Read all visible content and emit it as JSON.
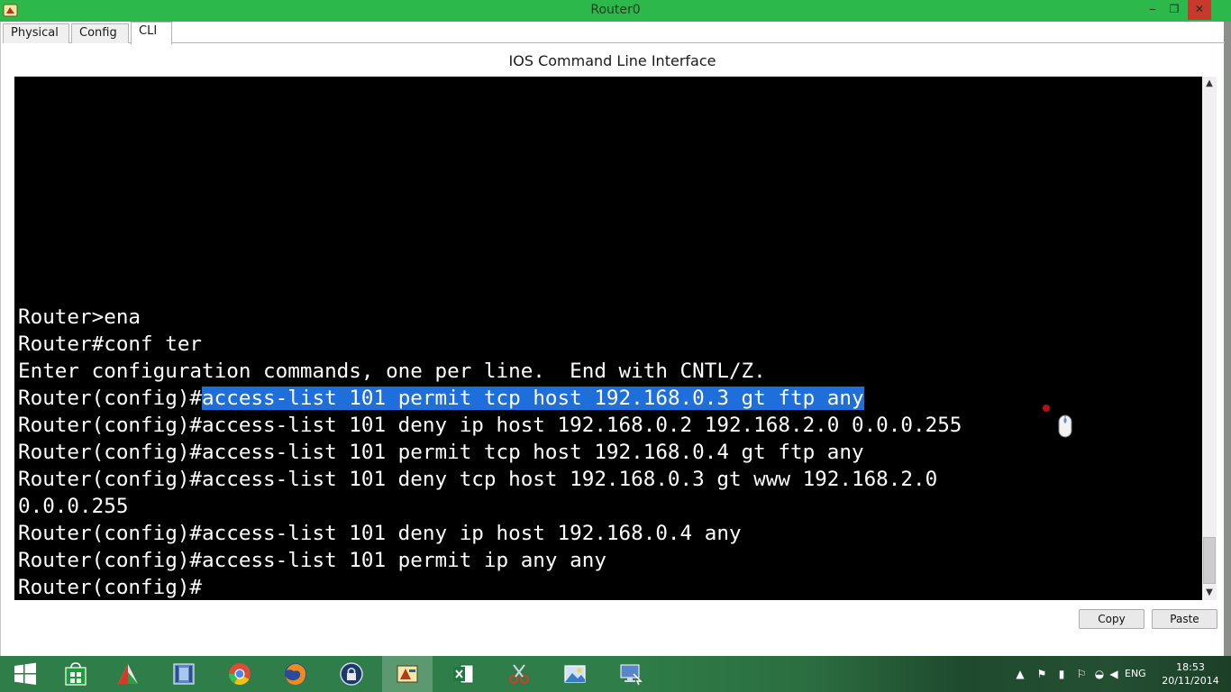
{
  "window": {
    "title": "Router0",
    "minimize_glyph": "‒",
    "maximize_glyph": "❐",
    "close_glyph": "✕"
  },
  "tabs": [
    {
      "label": "Physical"
    },
    {
      "label": "Config"
    },
    {
      "label": "CLI"
    }
  ],
  "cli": {
    "heading": "IOS Command Line Interface",
    "lines": [
      {
        "text": "Router>ena"
      },
      {
        "text": "Router#conf ter"
      },
      {
        "text": "Enter configuration commands, one per line.  End with CNTL/Z."
      },
      {
        "prompt": "Router(config)#",
        "selected": "access-list 101 permit tcp host 192.168.0.3 gt ftp any"
      },
      {
        "text": "Router(config)#access-list 101 deny ip host 192.168.0.2 192.168.2.0 0.0.0.255"
      },
      {
        "text": "Router(config)#access-list 101 permit tcp host 192.168.0.4 gt ftp any"
      },
      {
        "text": "Router(config)#access-list 101 deny tcp host 192.168.0.3 gt www 192.168.2.0"
      },
      {
        "text": "0.0.0.255"
      },
      {
        "text": "Router(config)#access-list 101 deny ip host 192.168.0.4 any"
      },
      {
        "text": "Router(config)#access-list 101 permit ip any any"
      },
      {
        "text": "Router(config)#"
      }
    ]
  },
  "buttons": {
    "copy": "Copy",
    "paste": "Paste"
  },
  "taskbar": {
    "apps": [
      {
        "icon": "windows-start-icon"
      },
      {
        "icon": "store-icon"
      },
      {
        "icon": "app-icon"
      },
      {
        "icon": "video-icon"
      },
      {
        "icon": "chrome-icon"
      },
      {
        "icon": "firefox-icon"
      },
      {
        "icon": "lock-icon"
      },
      {
        "icon": "packet-tracer-icon",
        "active": true
      },
      {
        "icon": "excel-icon"
      },
      {
        "icon": "snipping-tool-icon"
      },
      {
        "icon": "photos-icon"
      },
      {
        "icon": "remote-desktop-icon"
      }
    ],
    "language": "ENG",
    "time": "18:53",
    "date": "20/11/2014"
  },
  "colors": {
    "titlebar": "#2db84b",
    "close": "#c7392c",
    "selection": "#1e6fdb",
    "terminal_bg": "#000000",
    "taskbar": "#2f7d48"
  }
}
